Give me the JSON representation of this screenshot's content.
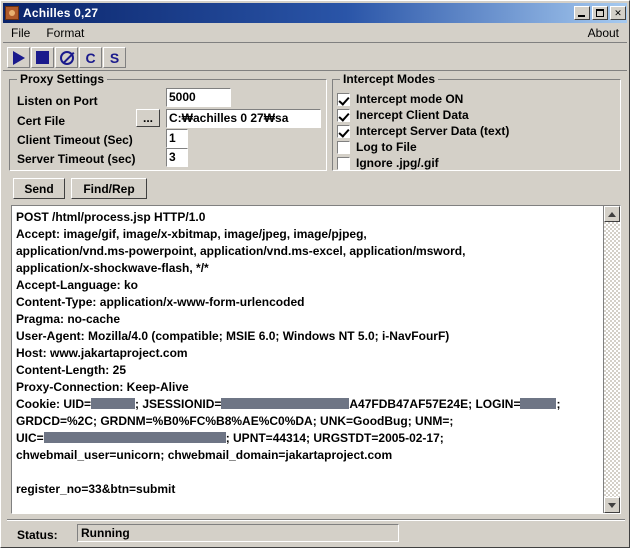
{
  "window": {
    "title": "Achilles 0,27",
    "icon": "achilles-app-icon",
    "buttons": {
      "minimize": "minimize-icon",
      "maximize": "maximize-icon",
      "close": "✕"
    }
  },
  "menubar": {
    "items": [
      {
        "label": "File"
      },
      {
        "label": "Format"
      }
    ],
    "right_item": {
      "label": "About"
    }
  },
  "toolbar": {
    "buttons": [
      {
        "name": "start-proxy-button",
        "icon": "play-icon",
        "glyph": ""
      },
      {
        "name": "stop-proxy-button",
        "icon": "stop-icon",
        "glyph": ""
      },
      {
        "name": "block-button",
        "icon": "no-entry-icon",
        "glyph": ""
      },
      {
        "name": "client-button",
        "icon": "letter-c-icon",
        "glyph": "C"
      },
      {
        "name": "server-button",
        "icon": "letter-s-icon",
        "glyph": "S"
      }
    ]
  },
  "proxy_settings": {
    "title": "Proxy Settings",
    "listen_port": {
      "label": "Listen on Port",
      "value": "5000"
    },
    "cert_file": {
      "label": "Cert File",
      "value": "C:₩achilles 0 27₩sa",
      "browse_label": "..."
    },
    "client_timeout": {
      "label": "Client Timeout (Sec)",
      "value": "1"
    },
    "server_timeout": {
      "label": "Server Timeout (sec)",
      "value": "3"
    }
  },
  "intercept_modes": {
    "title": "Intercept Modes",
    "options": [
      {
        "label": "Intercept mode ON",
        "checked": true
      },
      {
        "label": "Inercept Client Data",
        "checked": true
      },
      {
        "label": "Intercept Server Data (text)",
        "checked": true
      },
      {
        "label": "Log to File",
        "checked": false
      },
      {
        "label": "Ignore .jpg/.gif",
        "checked": false
      }
    ]
  },
  "actions": {
    "send_label": "Send",
    "find_replace_label": "Find/Rep"
  },
  "request_view": {
    "lines": [
      [
        {
          "t": "POST /html/process.jsp HTTP/1.0"
        }
      ],
      [
        {
          "t": "Accept: image/gif, image/x-xbitmap, image/jpeg, image/pjpeg,"
        }
      ],
      [
        {
          "t": "application/vnd.ms-powerpoint, application/vnd.ms-excel, application/msword,"
        }
      ],
      [
        {
          "t": "application/x-shockwave-flash, */*"
        }
      ],
      [
        {
          "t": "Accept-Language: ko"
        }
      ],
      [
        {
          "t": "Content-Type: application/x-www-form-urlencoded"
        }
      ],
      [
        {
          "t": "Pragma: no-cache"
        }
      ],
      [
        {
          "t": "User-Agent: Mozilla/4.0 (compatible; MSIE 6.0; Windows NT 5.0; i-NavFourF)"
        }
      ],
      [
        {
          "t": "Host: www.jakartaproject.com"
        }
      ],
      [
        {
          "t": "Content-Length: 25"
        }
      ],
      [
        {
          "t": "Proxy-Connection: Keep-Alive"
        }
      ],
      [
        {
          "t": "Cookie: UID="
        },
        {
          "redacted": 44
        },
        {
          "t": "; JSESSIONID="
        },
        {
          "redacted": 128
        },
        {
          "t": "A47FDB47AF57E24E; LOGIN="
        },
        {
          "redacted": 36
        },
        {
          "t": ";"
        }
      ],
      [
        {
          "t": "GRDCD=%2C; GRDNM=%B0%FC%B8%AE%C0%DA; UNK=GoodBug; UNM=;"
        }
      ],
      [
        {
          "t": "UIC="
        },
        {
          "redacted": 182
        },
        {
          "t": "; UPNT=44314; URGSTDT=2005-02-17;"
        }
      ],
      [
        {
          "t": "chwebmail_user=unicorn; chwebmail_domain=jakartaproject.com"
        }
      ],
      [
        {
          "t": ""
        }
      ],
      [
        {
          "t": "register_no=33&btn=submit"
        }
      ]
    ]
  },
  "statusbar": {
    "label": "Status:",
    "value": "Running"
  }
}
